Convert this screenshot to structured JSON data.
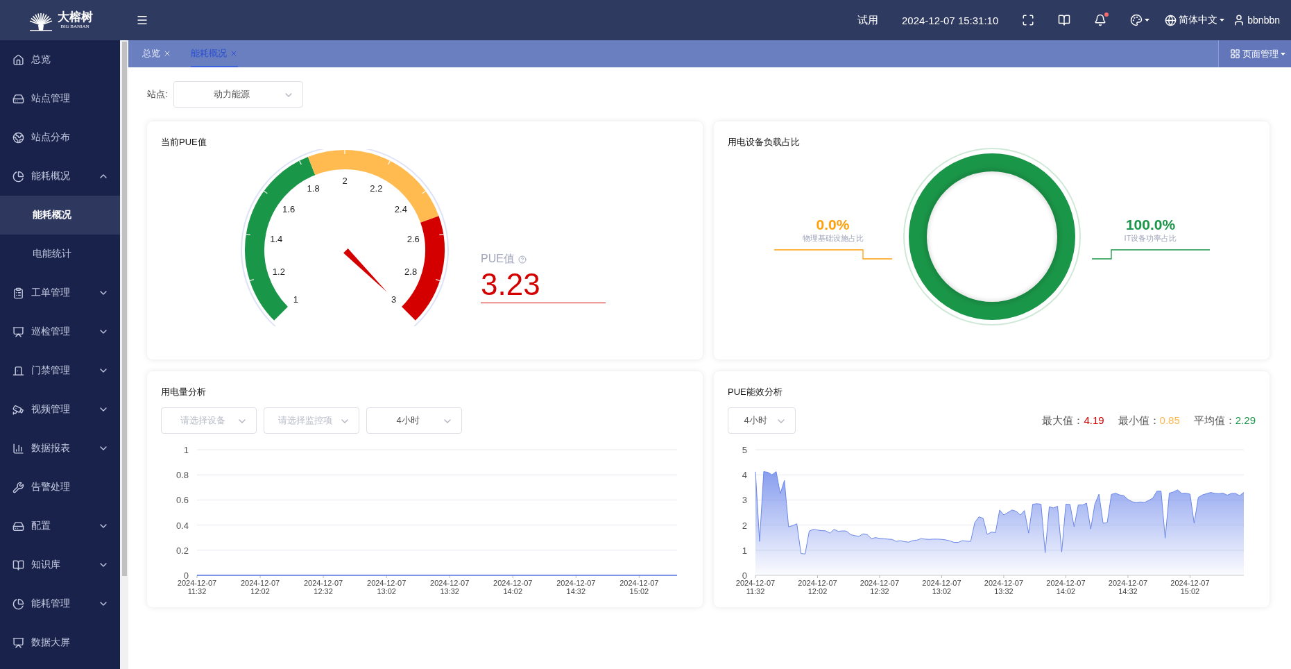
{
  "header": {
    "logo": {
      "name": "大榕树",
      "subtitle": "BIG BANIAN"
    },
    "trial": "试用",
    "datetime": "2024-12-07 15:31:10",
    "notification_dot": true,
    "language": "简体中文",
    "user": "bbnbbn"
  },
  "sidebar": {
    "items": [
      {
        "label": "总览",
        "selected": false
      },
      {
        "label": "站点管理",
        "selected": false
      },
      {
        "label": "站点分布",
        "selected": false
      },
      {
        "label": "能耗概况",
        "selected": false,
        "expanded": true,
        "children": [
          {
            "label": "能耗概况",
            "selected": true
          },
          {
            "label": "电能统计",
            "selected": false
          }
        ]
      },
      {
        "label": "工单管理",
        "selected": false,
        "expanded": false
      },
      {
        "label": "巡检管理",
        "selected": false,
        "expanded": false
      },
      {
        "label": "门禁管理",
        "selected": false,
        "expanded": false
      },
      {
        "label": "视频管理",
        "selected": false,
        "expanded": false
      },
      {
        "label": "数据报表",
        "selected": false,
        "expanded": false
      },
      {
        "label": "告警处理",
        "selected": false
      },
      {
        "label": "配置",
        "selected": false,
        "expanded": false
      },
      {
        "label": "知识库",
        "selected": false,
        "expanded": false
      },
      {
        "label": "能耗管理",
        "selected": false,
        "expanded": false
      },
      {
        "label": "数据大屏",
        "selected": false
      }
    ]
  },
  "tabs": [
    {
      "label": "总览",
      "selected": false
    },
    {
      "label": "能耗概况",
      "selected": true
    }
  ],
  "page_manage": "页面管理",
  "filter": {
    "label": "站点:",
    "value": "动力能源"
  },
  "pue_card": {
    "title": "当前PUE值",
    "gauge": {
      "ticks": [
        "1",
        "1.2",
        "1.4",
        "1.6",
        "1.8",
        "2",
        "2.2",
        "2.4",
        "2.6",
        "2.8",
        "3"
      ]
    },
    "label": "PUE值",
    "value": "3.23"
  },
  "load_card": {
    "title": "用电设备负载占比",
    "items": [
      {
        "value": "0.0%",
        "label": "物理基础设施占比",
        "color": "#ff9f0a"
      },
      {
        "value": "100.0%",
        "label": "IT设备功率占比",
        "color": "#1a9648"
      }
    ]
  },
  "power_card": {
    "title": "用电量分析",
    "selects": [
      {
        "placeholder": "请选择设备"
      },
      {
        "placeholder": "请选择监控项"
      },
      {
        "value": "4小时"
      }
    ],
    "chart_data": {
      "type": "line",
      "grid": true,
      "ylim": [
        0,
        1
      ],
      "yticks": [
        0,
        0.2,
        0.4,
        0.6,
        0.8,
        1
      ],
      "categories": [
        "2024-12-07\n11:32",
        null,
        null,
        null,
        null,
        null,
        null,
        null,
        null,
        null,
        null,
        null,
        null,
        null,
        null,
        "2024-12-07\n12:02",
        null,
        null,
        null,
        null,
        null,
        null,
        null,
        null,
        null,
        null,
        null,
        null,
        null,
        null,
        "2024-12-07\n12:32",
        null,
        null,
        null,
        null,
        null,
        null,
        null,
        null,
        null,
        null,
        null,
        null,
        null,
        null,
        "2024-12-07\n13:02",
        null,
        null,
        null,
        null,
        null,
        null,
        null,
        null,
        null,
        null,
        null,
        null,
        null,
        null,
        "2024-12-07\n13:32",
        null,
        null,
        null,
        null,
        null,
        null,
        null,
        null,
        null,
        null,
        null,
        null,
        null,
        null,
        "2024-12-07\n14:02",
        null,
        null,
        null,
        null,
        null,
        null,
        null,
        null,
        null,
        null,
        null,
        null,
        null,
        null,
        "2024-12-07\n14:32",
        null,
        null,
        null,
        null,
        null,
        null,
        null,
        null,
        null,
        null,
        null,
        null,
        null,
        null,
        "2024-12-07\n15:02",
        null,
        null,
        null,
        null,
        null,
        null,
        null,
        null,
        null
      ],
      "series": [
        {
          "color": "#5b7bea",
          "values": [
            0,
            0,
            0,
            0,
            0,
            0,
            0,
            0,
            0,
            0,
            0,
            0,
            0,
            0,
            0,
            0,
            0,
            0,
            0,
            0,
            0,
            0,
            0,
            0,
            0,
            0,
            0,
            0,
            0,
            0,
            0,
            0,
            0,
            0,
            0,
            0,
            0,
            0,
            0,
            0,
            0,
            0,
            0,
            0,
            0,
            0,
            0,
            0,
            0,
            0,
            0,
            0,
            0,
            0,
            0,
            0,
            0,
            0,
            0,
            0,
            0,
            0,
            0,
            0,
            0,
            0,
            0,
            0,
            0,
            0,
            0,
            0,
            0,
            0,
            0,
            0,
            0,
            0,
            0,
            0,
            0,
            0,
            0,
            0,
            0,
            0,
            0,
            0,
            0,
            0,
            0,
            0,
            0,
            0,
            0,
            0,
            0,
            0,
            0,
            0,
            0,
            0,
            0,
            0,
            0,
            0,
            0,
            0,
            0,
            0,
            0,
            0,
            0,
            0,
            0
          ]
        }
      ]
    }
  },
  "pue_trend_card": {
    "title": "PUE能效分析",
    "select": {
      "value": "4小时"
    },
    "stats": [
      {
        "label": "最大值：",
        "value": "4.19",
        "color": "#d40000"
      },
      {
        "label": "最小值：",
        "value": "0.85",
        "color": "#ffb84d"
      },
      {
        "label": "平均值：",
        "value": "2.29",
        "color": "#1a9648"
      }
    ],
    "chart_data": {
      "type": "area",
      "grid": true,
      "ylim": [
        0,
        5
      ],
      "yticks": [
        0,
        1,
        2,
        3,
        4,
        5
      ],
      "categories": [
        "2024-12-07\n11:32",
        null,
        null,
        null,
        null,
        null,
        null,
        null,
        null,
        null,
        null,
        null,
        null,
        null,
        null,
        "2024-12-07\n12:02",
        null,
        null,
        null,
        null,
        null,
        null,
        null,
        null,
        null,
        null,
        null,
        null,
        null,
        null,
        "2024-12-07\n12:32",
        null,
        null,
        null,
        null,
        null,
        null,
        null,
        null,
        null,
        null,
        null,
        null,
        null,
        null,
        "2024-12-07\n13:02",
        null,
        null,
        null,
        null,
        null,
        null,
        null,
        null,
        null,
        null,
        null,
        null,
        null,
        null,
        "2024-12-07\n13:32",
        null,
        null,
        null,
        null,
        null,
        null,
        null,
        null,
        null,
        null,
        null,
        null,
        null,
        null,
        "2024-12-07\n14:02",
        null,
        null,
        null,
        null,
        null,
        null,
        null,
        null,
        null,
        null,
        null,
        null,
        null,
        null,
        "2024-12-07\n14:32",
        null,
        null,
        null,
        null,
        null,
        null,
        null,
        null,
        null,
        null,
        null,
        null,
        null,
        null,
        "2024-12-07\n15:02",
        null,
        null,
        null,
        null,
        null,
        null,
        null,
        null,
        null,
        null,
        null,
        null,
        null
      ],
      "series": [
        {
          "color": "#6b86ea",
          "values": [
            4.12,
            1.35,
            4.13,
            4.1,
            4.0,
            4.13,
            3.25,
            3.78,
            1.93,
            1.98,
            2.05,
            0.87,
            0.85,
            1.76,
            1.83,
            1.8,
            1.78,
            1.77,
            1.68,
            1.83,
            1.75,
            1.77,
            1.76,
            1.62,
            1.58,
            1.55,
            1.65,
            1.62,
            1.46,
            1.5,
            1.47,
            1.46,
            1.44,
            1.43,
            1.35,
            1.38,
            1.34,
            1.32,
            1.38,
            1.4,
            1.46,
            1.44,
            1.43,
            1.44,
            1.44,
            1.43,
            1.41,
            1.37,
            1.31,
            1.31,
            1.38,
            1.36,
            1.35,
            2.1,
            2.33,
            2.27,
            1.63,
            1.72,
            1.7,
            2.6,
            2.4,
            2.5,
            2.6,
            2.55,
            2.4,
            2.58,
            1.68,
            2.83,
            2.85,
            2.83,
            0.9,
            2.73,
            2.68,
            2.75,
            0.93,
            2.83,
            2.82,
            1.93,
            2.8,
            2.8,
            2.87,
            1.84,
            2.83,
            3.23,
            2.07,
            2.1,
            3.22,
            3.27,
            3.2,
            3.17,
            3.02,
            2.93,
            2.9,
            2.92,
            2.9,
            2.98,
            3.07,
            3.35,
            3.35,
            1.48,
            3.27,
            3.32,
            3.4,
            3.26,
            3.27,
            3.23,
            2.07,
            3.1,
            3.2,
            3.25,
            3.3,
            3.26,
            3.25,
            3.27,
            3.19,
            3.26,
            3.26,
            3.17,
            3.3
          ]
        }
      ]
    }
  }
}
